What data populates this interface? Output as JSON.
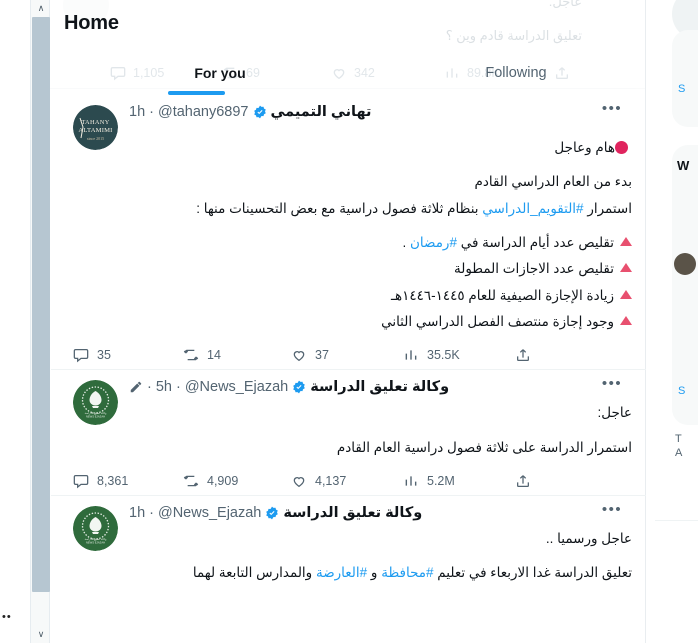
{
  "window": {
    "app": "Twitter / X",
    "scrollbar": {
      "up_arrow": "∧",
      "down_arrow": "∨",
      "overflow_dots": "••"
    }
  },
  "header": {
    "title": "Home"
  },
  "tabs": [
    {
      "label": "For you",
      "selected": true
    },
    {
      "label": "Following",
      "selected": false
    }
  ],
  "ghost_layer": {
    "line_1": "عاجل.",
    "line_2": "تعليق الدراسة قادم وين ؟",
    "actions": {
      "replies": "1,105",
      "retweets": "69",
      "likes": "342",
      "views": "89.8K"
    }
  },
  "tweets": [
    {
      "avatar_type": "tahany-logo",
      "avatar_alt": "TAHANY ALTAMIMI",
      "display_name": "تهاني التميمي",
      "verified": true,
      "handle": "@tahany6897",
      "separator": "·",
      "timestamp": "1h",
      "more": "•••",
      "body": [
        {
          "kind": "emoji_line",
          "text": "هام وعاجل",
          "emoji": "red-circle"
        },
        {
          "kind": "blank"
        },
        {
          "kind": "plain",
          "text": "بدء من العام الدراسي القادم"
        },
        {
          "kind": "mixed",
          "pre": "استمرار ",
          "link": "#التقويم_الدراسي",
          "post": " بنظام ثلاثة فصول دراسية مع بعض التحسينات منها :"
        },
        {
          "kind": "blank"
        },
        {
          "kind": "bullet_mixed",
          "pre": "تقليص عدد أيام الدراسة في ",
          "link": "#رمضان",
          "post": " ."
        },
        {
          "kind": "bullet",
          "text": "تقليص عدد الاجازات المطولة"
        },
        {
          "kind": "bullet",
          "text": "زيادة الإجازة الصيفية للعام ١٤٤٥-١٤٤٦هـ"
        },
        {
          "kind": "bullet",
          "text": "وجود إجازة منتصف الفصل الدراسي الثاني"
        }
      ],
      "actions": {
        "replies": "35",
        "retweets": "14",
        "likes": "37",
        "views": "35.5K",
        "share": ""
      }
    },
    {
      "avatar_type": "ejazah-logo",
      "avatar_alt": "وكالة تعليق الدراسة",
      "display_name": "وكالة تعليق الدراسة",
      "verified": true,
      "handle": "@News_Ejazah",
      "separator": "·",
      "timestamp": "5h",
      "edited": true,
      "more": "•••",
      "body": [
        {
          "kind": "plain",
          "text": "عاجل:"
        },
        {
          "kind": "blank"
        },
        {
          "kind": "plain",
          "text": "استمرار الدراسة على ثلاثة فصول دراسية العام القادم"
        }
      ],
      "actions": {
        "replies": "8,361",
        "retweets": "4,909",
        "likes": "4,137",
        "views": "5.2M",
        "share": ""
      }
    },
    {
      "avatar_type": "ejazah-logo",
      "avatar_alt": "وكالة تعليق الدراسة",
      "display_name": "وكالة تعليق الدراسة",
      "verified": true,
      "handle": "@News_Ejazah",
      "separator": "·",
      "timestamp": "1h",
      "more": "•••",
      "body": [
        {
          "kind": "plain",
          "text": "عاجل ورسميا .."
        },
        {
          "kind": "blank"
        },
        {
          "kind": "mixed3",
          "pre": "تعليق الدراسة غدا الاربعاء في تعليم ",
          "link1": "#محافظة",
          "mid": " و ",
          "link2": "#العارضة",
          "post": " والمدارس التابعة لهما"
        }
      ]
    }
  ],
  "colors": {
    "accent": "#1d9bf0",
    "text": "#0f1419",
    "muted": "#536471",
    "border": "#eff3f4",
    "red": "#e0245e",
    "triangle": "#e8506f",
    "scrollbar_thumb": "#b6c6d1"
  }
}
